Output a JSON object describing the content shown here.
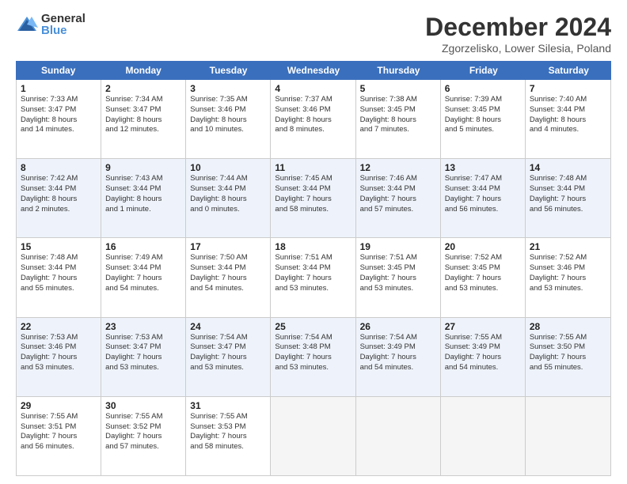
{
  "logo": {
    "general": "General",
    "blue": "Blue"
  },
  "title": "December 2024",
  "subtitle": "Zgorzelisko, Lower Silesia, Poland",
  "days": [
    "Sunday",
    "Monday",
    "Tuesday",
    "Wednesday",
    "Thursday",
    "Friday",
    "Saturday"
  ],
  "weeks": [
    [
      {
        "day": "1",
        "sunrise": "7:33 AM",
        "sunset": "3:47 PM",
        "daylight": "8 hours and 14 minutes."
      },
      {
        "day": "2",
        "sunrise": "7:34 AM",
        "sunset": "3:47 PM",
        "daylight": "8 hours and 12 minutes."
      },
      {
        "day": "3",
        "sunrise": "7:35 AM",
        "sunset": "3:46 PM",
        "daylight": "8 hours and 10 minutes."
      },
      {
        "day": "4",
        "sunrise": "7:37 AM",
        "sunset": "3:46 PM",
        "daylight": "8 hours and 8 minutes."
      },
      {
        "day": "5",
        "sunrise": "7:38 AM",
        "sunset": "3:45 PM",
        "daylight": "8 hours and 7 minutes."
      },
      {
        "day": "6",
        "sunrise": "7:39 AM",
        "sunset": "3:45 PM",
        "daylight": "8 hours and 5 minutes."
      },
      {
        "day": "7",
        "sunrise": "7:40 AM",
        "sunset": "3:44 PM",
        "daylight": "8 hours and 4 minutes."
      }
    ],
    [
      {
        "day": "8",
        "sunrise": "7:42 AM",
        "sunset": "3:44 PM",
        "daylight": "8 hours and 2 minutes."
      },
      {
        "day": "9",
        "sunrise": "7:43 AM",
        "sunset": "3:44 PM",
        "daylight": "8 hours and 1 minute."
      },
      {
        "day": "10",
        "sunrise": "7:44 AM",
        "sunset": "3:44 PM",
        "daylight": "8 hours and 0 minutes."
      },
      {
        "day": "11",
        "sunrise": "7:45 AM",
        "sunset": "3:44 PM",
        "daylight": "7 hours and 58 minutes."
      },
      {
        "day": "12",
        "sunrise": "7:46 AM",
        "sunset": "3:44 PM",
        "daylight": "7 hours and 57 minutes."
      },
      {
        "day": "13",
        "sunrise": "7:47 AM",
        "sunset": "3:44 PM",
        "daylight": "7 hours and 56 minutes."
      },
      {
        "day": "14",
        "sunrise": "7:48 AM",
        "sunset": "3:44 PM",
        "daylight": "7 hours and 56 minutes."
      }
    ],
    [
      {
        "day": "15",
        "sunrise": "7:48 AM",
        "sunset": "3:44 PM",
        "daylight": "7 hours and 55 minutes."
      },
      {
        "day": "16",
        "sunrise": "7:49 AM",
        "sunset": "3:44 PM",
        "daylight": "7 hours and 54 minutes."
      },
      {
        "day": "17",
        "sunrise": "7:50 AM",
        "sunset": "3:44 PM",
        "daylight": "7 hours and 54 minutes."
      },
      {
        "day": "18",
        "sunrise": "7:51 AM",
        "sunset": "3:44 PM",
        "daylight": "7 hours and 53 minutes."
      },
      {
        "day": "19",
        "sunrise": "7:51 AM",
        "sunset": "3:45 PM",
        "daylight": "7 hours and 53 minutes."
      },
      {
        "day": "20",
        "sunrise": "7:52 AM",
        "sunset": "3:45 PM",
        "daylight": "7 hours and 53 minutes."
      },
      {
        "day": "21",
        "sunrise": "7:52 AM",
        "sunset": "3:46 PM",
        "daylight": "7 hours and 53 minutes."
      }
    ],
    [
      {
        "day": "22",
        "sunrise": "7:53 AM",
        "sunset": "3:46 PM",
        "daylight": "7 hours and 53 minutes."
      },
      {
        "day": "23",
        "sunrise": "7:53 AM",
        "sunset": "3:47 PM",
        "daylight": "7 hours and 53 minutes."
      },
      {
        "day": "24",
        "sunrise": "7:54 AM",
        "sunset": "3:47 PM",
        "daylight": "7 hours and 53 minutes."
      },
      {
        "day": "25",
        "sunrise": "7:54 AM",
        "sunset": "3:48 PM",
        "daylight": "7 hours and 53 minutes."
      },
      {
        "day": "26",
        "sunrise": "7:54 AM",
        "sunset": "3:49 PM",
        "daylight": "7 hours and 54 minutes."
      },
      {
        "day": "27",
        "sunrise": "7:55 AM",
        "sunset": "3:49 PM",
        "daylight": "7 hours and 54 minutes."
      },
      {
        "day": "28",
        "sunrise": "7:55 AM",
        "sunset": "3:50 PM",
        "daylight": "7 hours and 55 minutes."
      }
    ],
    [
      {
        "day": "29",
        "sunrise": "7:55 AM",
        "sunset": "3:51 PM",
        "daylight": "7 hours and 56 minutes."
      },
      {
        "day": "30",
        "sunrise": "7:55 AM",
        "sunset": "3:52 PM",
        "daylight": "7 hours and 57 minutes."
      },
      {
        "day": "31",
        "sunrise": "7:55 AM",
        "sunset": "3:53 PM",
        "daylight": "7 hours and 58 minutes."
      },
      null,
      null,
      null,
      null
    ]
  ]
}
